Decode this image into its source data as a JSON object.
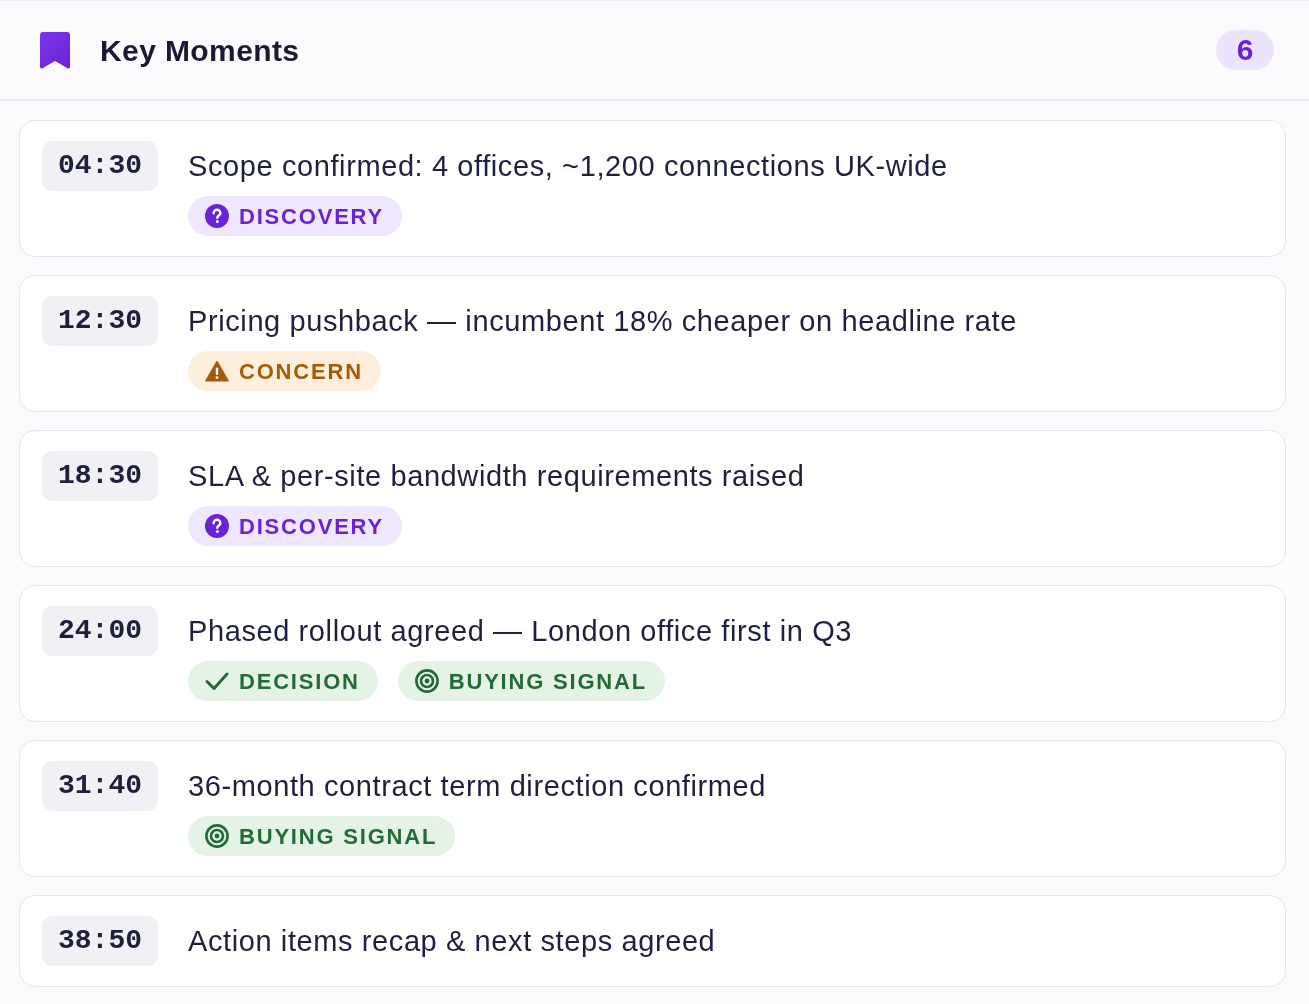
{
  "panel": {
    "title": "Key Moments",
    "count": "6"
  },
  "moments": [
    {
      "time": "04:30",
      "text": "Scope confirmed: 4 offices, ~1,200 connections UK-wide",
      "tags": [
        {
          "kind": "discovery",
          "label": "DISCOVERY"
        }
      ]
    },
    {
      "time": "12:30",
      "text": "Pricing pushback — incumbent 18% cheaper on headline rate",
      "tags": [
        {
          "kind": "concern",
          "label": "CONCERN"
        }
      ]
    },
    {
      "time": "18:30",
      "text": "SLA & per-site bandwidth requirements raised",
      "tags": [
        {
          "kind": "discovery",
          "label": "DISCOVERY"
        }
      ]
    },
    {
      "time": "24:00",
      "text": "Phased rollout agreed — London office first in Q3",
      "tags": [
        {
          "kind": "decision",
          "label": "DECISION"
        },
        {
          "kind": "buying_signal",
          "label": "BUYING SIGNAL"
        }
      ]
    },
    {
      "time": "31:40",
      "text": "36-month contract term direction confirmed",
      "tags": [
        {
          "kind": "buying_signal",
          "label": "BUYING SIGNAL"
        }
      ]
    },
    {
      "time": "38:50",
      "text": "Action items recap & next steps agreed"
    }
  ]
}
